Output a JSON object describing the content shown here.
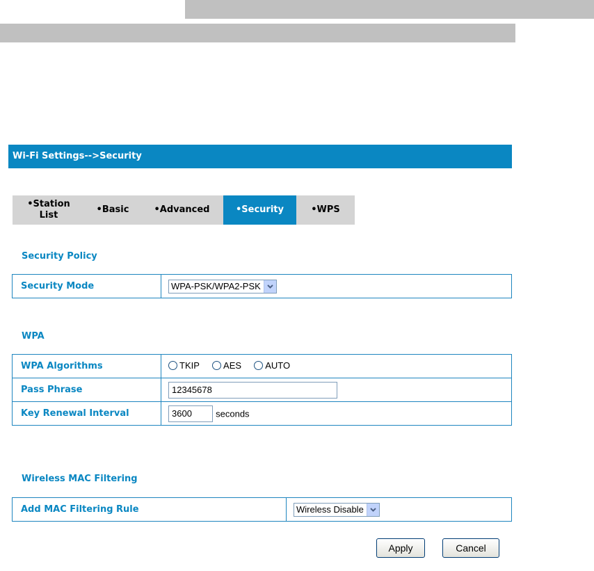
{
  "header": {
    "title": "Wi-Fi Settings-->Security"
  },
  "tabs": [
    {
      "line1": "•Station",
      "line2": "List"
    },
    {
      "label": "•Basic"
    },
    {
      "label": "•Advanced"
    },
    {
      "label": "•Security",
      "active": true
    },
    {
      "label": "•WPS"
    }
  ],
  "security_policy": {
    "title": "Security Policy",
    "mode_label": "Security Mode",
    "mode_value": "WPA-PSK/WPA2-PSK"
  },
  "wpa": {
    "title": "WPA",
    "algorithms_label": "WPA Algorithms",
    "algorithms": [
      "TKIP",
      "AES",
      "AUTO"
    ],
    "pass_label": "Pass Phrase",
    "pass_value": "12345678",
    "renewal_label": "Key Renewal Interval",
    "renewal_value": "3600",
    "renewal_unit": "seconds"
  },
  "mac_filter": {
    "title": "Wireless MAC Filtering",
    "rule_label": "Add MAC Filtering Rule",
    "rule_value": "Wireless Disable"
  },
  "buttons": {
    "apply": "Apply",
    "cancel": "Cancel"
  },
  "colors": {
    "accent": "#0a87c2",
    "tab_bg": "#d4d4d4",
    "top_bars": "#c0c0c0"
  }
}
